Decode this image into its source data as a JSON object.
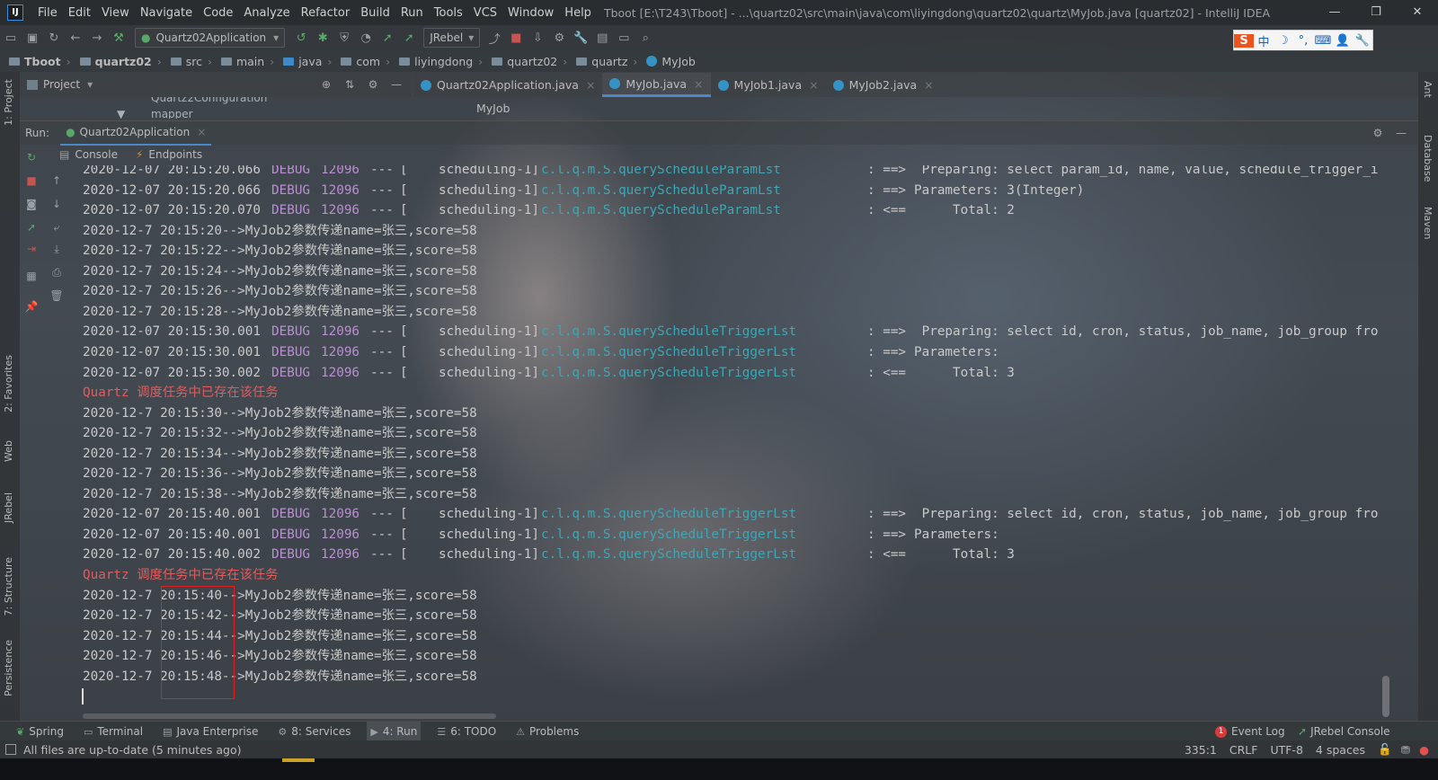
{
  "window": {
    "title": "Tboot [E:\\T243\\Tboot] - ...\\quartz02\\src\\main\\java\\com\\liyingdong\\quartz02\\quartz\\MyJob.java [quartz02] - IntelliJ IDEA",
    "logo_text": "IJ"
  },
  "menu": [
    "File",
    "Edit",
    "View",
    "Navigate",
    "Code",
    "Analyze",
    "Refactor",
    "Build",
    "Run",
    "Tools",
    "VCS",
    "Window",
    "Help"
  ],
  "toolbar": {
    "run_config": "Quartz02Application",
    "jrebel": "JRebel",
    "ime_glyphs": [
      "中",
      "☽",
      "°,",
      "⌨",
      "👤",
      "🔧"
    ]
  },
  "breadcrumb": [
    "Tboot",
    "quartz02",
    "src",
    "main",
    "java",
    "com",
    "liyingdong",
    "quartz02",
    "quartz",
    "MyJob"
  ],
  "project_panel": {
    "title": "Project",
    "tree": [
      "Quartz2Configuration",
      "mapper"
    ]
  },
  "editor": {
    "tabs": [
      "Quartz02Application.java",
      "MyJob.java",
      "MyJob1.java",
      "MyJob2.java"
    ],
    "active_tab": "MyJob.java",
    "structure_crumb": "MyJob"
  },
  "run_panel": {
    "label": "Run:",
    "config_tab": "Quartz02Application",
    "subtabs": [
      "Console",
      "Endpoints"
    ]
  },
  "console": {
    "lines": [
      {
        "kind": "debug",
        "ts": "2020-12-07 20:15:20.066",
        "level": "DEBUG",
        "pid": "12096",
        "sep": "---",
        "thread": "[    scheduling-1]",
        "logger": "c.l.q.m.S.queryScheduleParamLst",
        "arrow": ": ==>",
        "msg": " Preparing: select param_id, name, value, schedule_trigger_i"
      },
      {
        "kind": "debug",
        "ts": "2020-12-07 20:15:20.066",
        "level": "DEBUG",
        "pid": "12096",
        "sep": "---",
        "thread": "[    scheduling-1]",
        "logger": "c.l.q.m.S.queryScheduleParamLst",
        "arrow": ": ==>",
        "msg": "Parameters: 3(Integer)"
      },
      {
        "kind": "debug",
        "ts": "2020-12-07 20:15:20.070",
        "level": "DEBUG",
        "pid": "12096",
        "sep": "---",
        "thread": "[    scheduling-1]",
        "logger": "c.l.q.m.S.queryScheduleParamLst",
        "arrow": ": <==",
        "msg": "     Total: 2"
      },
      {
        "kind": "plain",
        "text": "2020-12-7 20:15:20-->MyJob2参数传递name=张三,score=58"
      },
      {
        "kind": "plain",
        "text": "2020-12-7 20:15:22-->MyJob2参数传递name=张三,score=58"
      },
      {
        "kind": "plain",
        "text": "2020-12-7 20:15:24-->MyJob2参数传递name=张三,score=58"
      },
      {
        "kind": "plain",
        "text": "2020-12-7 20:15:26-->MyJob2参数传递name=张三,score=58"
      },
      {
        "kind": "plain",
        "text": "2020-12-7 20:15:28-->MyJob2参数传递name=张三,score=58"
      },
      {
        "kind": "debug",
        "ts": "2020-12-07 20:15:30.001",
        "level": "DEBUG",
        "pid": "12096",
        "sep": "---",
        "thread": "[    scheduling-1]",
        "logger": "c.l.q.m.S.queryScheduleTriggerLst",
        "arrow": ": ==>",
        "msg": " Preparing: select id, cron, status, job_name, job_group fro"
      },
      {
        "kind": "debug",
        "ts": "2020-12-07 20:15:30.001",
        "level": "DEBUG",
        "pid": "12096",
        "sep": "---",
        "thread": "[    scheduling-1]",
        "logger": "c.l.q.m.S.queryScheduleTriggerLst",
        "arrow": ": ==>",
        "msg": "Parameters: "
      },
      {
        "kind": "debug",
        "ts": "2020-12-07 20:15:30.002",
        "level": "DEBUG",
        "pid": "12096",
        "sep": "---",
        "thread": "[    scheduling-1]",
        "logger": "c.l.q.m.S.queryScheduleTriggerLst",
        "arrow": ": <==",
        "msg": "     Total: 3"
      },
      {
        "kind": "error",
        "text": "Quartz 调度任务中已存在该任务"
      },
      {
        "kind": "plain",
        "text": "2020-12-7 20:15:30-->MyJob2参数传递name=张三,score=58"
      },
      {
        "kind": "plain",
        "text": "2020-12-7 20:15:32-->MyJob2参数传递name=张三,score=58"
      },
      {
        "kind": "plain",
        "text": "2020-12-7 20:15:34-->MyJob2参数传递name=张三,score=58"
      },
      {
        "kind": "plain",
        "text": "2020-12-7 20:15:36-->MyJob2参数传递name=张三,score=58"
      },
      {
        "kind": "plain",
        "text": "2020-12-7 20:15:38-->MyJob2参数传递name=张三,score=58"
      },
      {
        "kind": "debug",
        "ts": "2020-12-07 20:15:40.001",
        "level": "DEBUG",
        "pid": "12096",
        "sep": "---",
        "thread": "[    scheduling-1]",
        "logger": "c.l.q.m.S.queryScheduleTriggerLst",
        "arrow": ": ==>",
        "msg": " Preparing: select id, cron, status, job_name, job_group fro"
      },
      {
        "kind": "debug",
        "ts": "2020-12-07 20:15:40.001",
        "level": "DEBUG",
        "pid": "12096",
        "sep": "---",
        "thread": "[    scheduling-1]",
        "logger": "c.l.q.m.S.queryScheduleTriggerLst",
        "arrow": ": ==>",
        "msg": "Parameters: "
      },
      {
        "kind": "debug",
        "ts": "2020-12-07 20:15:40.002",
        "level": "DEBUG",
        "pid": "12096",
        "sep": "---",
        "thread": "[    scheduling-1]",
        "logger": "c.l.q.m.S.queryScheduleTriggerLst",
        "arrow": ": <==",
        "msg": "     Total: 3"
      },
      {
        "kind": "error",
        "text": "Quartz 调度任务中已存在该任务"
      },
      {
        "kind": "plain",
        "text": "2020-12-7 20:15:40-->MyJob2参数传递name=张三,score=58"
      },
      {
        "kind": "plain",
        "text": "2020-12-7 20:15:42-->MyJob2参数传递name=张三,score=58"
      },
      {
        "kind": "plain",
        "text": "2020-12-7 20:15:44-->MyJob2参数传递name=张三,score=58"
      },
      {
        "kind": "plain",
        "text": "2020-12-7 20:15:46-->MyJob2参数传递name=张三,score=58"
      },
      {
        "kind": "plain",
        "text": "2020-12-7 20:15:48-->MyJob2参数传递name=张三,score=58"
      }
    ]
  },
  "left_strip": [
    "1: Project",
    "2: Favorites",
    "Web",
    "JRebel",
    "7: Structure",
    "Persistence"
  ],
  "right_strip": [
    "Ant",
    "Database",
    "Maven"
  ],
  "bottom_tabs": [
    {
      "label": "Spring",
      "icon": "spring-icon"
    },
    {
      "label": "Terminal",
      "icon": "terminal-icon"
    },
    {
      "label": "Java Enterprise",
      "icon": "java-enterprise-icon"
    },
    {
      "label": "8: Services",
      "icon": "services-icon"
    },
    {
      "label": "4: Run",
      "icon": "run-icon"
    },
    {
      "label": "6: TODO",
      "icon": "todo-icon"
    },
    {
      "label": "Problems",
      "icon": "problems-icon"
    }
  ],
  "bottom_right_tabs": {
    "event_log": "Event Log",
    "event_count": "1",
    "jrebel_console": "JRebel Console"
  },
  "status": {
    "message": "All files are up-to-date (5 minutes ago)",
    "position": "335:1",
    "line_sep": "CRLF",
    "encoding": "UTF-8",
    "indent": "4 spaces"
  },
  "colors": {
    "debug": "#b98fd1",
    "logger": "#3ea6b4",
    "error": "#e05d5d",
    "accent": "#4a88c7",
    "highlight_box": "#e02020"
  }
}
